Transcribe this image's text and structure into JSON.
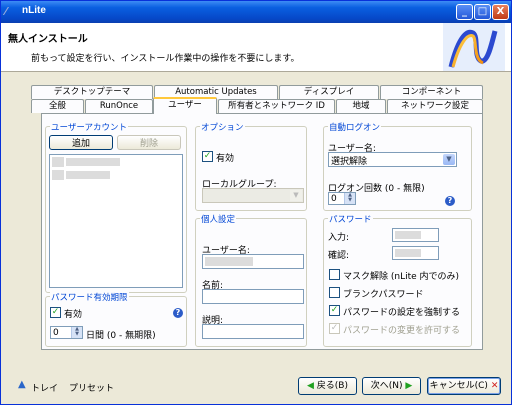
{
  "window": {
    "title": "nLite",
    "min": "_",
    "max": "□",
    "close": "X"
  },
  "banner": {
    "heading": "無人インストール",
    "description": "前もって設定を行い、インストール作業中の操作を不要にします。"
  },
  "tabs": {
    "row1": [
      "デスクトップテーマ",
      "Automatic Updates",
      "ディスプレイ",
      "コンポーネント"
    ],
    "row2": [
      "全般",
      "RunOnce",
      "ユーザー",
      "所有者とネットワーク ID",
      "地域",
      "ネットワーク設定"
    ],
    "active": "ユーザー"
  },
  "user_account": {
    "title": "ユーザーアカウント",
    "add": "追加",
    "delete": "削除"
  },
  "options": {
    "title": "オプション",
    "enabled_label": "有効",
    "enabled": true,
    "local_group_label": "ローカルグループ:"
  },
  "autologon": {
    "title": "自動ログオン",
    "username_label": "ユーザー名:",
    "username_value": "選択解除",
    "count_label": "ログオン回数 (0 - 無限)",
    "count_value": "0"
  },
  "personal": {
    "title": "個人設定",
    "username_label": "ユーザー名:",
    "name_label": "名前:",
    "description_label": "説明:"
  },
  "password": {
    "title": "パスワード",
    "input_label": "入力:",
    "confirm_label": "確認:",
    "checkboxes": [
      {
        "label": "マスク解除 (nLite 内でのみ)",
        "checked": false,
        "disabled": false
      },
      {
        "label": "ブランクパスワード",
        "checked": false,
        "disabled": false
      },
      {
        "label": "パスワードの設定を強制する",
        "checked": true,
        "disabled": false
      },
      {
        "label": "パスワードの変更を許可する",
        "checked": true,
        "disabled": true
      }
    ]
  },
  "expiry": {
    "title": "パスワード有効期限",
    "enabled_label": "有効",
    "enabled": true,
    "days_value": "0",
    "days_label": "日間 (0 - 無期限)"
  },
  "footer": {
    "tray": "トレイ",
    "preset": "プリセット",
    "back": "戻る(B)",
    "next": "次へ(N)",
    "cancel": "キャンセル(C)"
  }
}
